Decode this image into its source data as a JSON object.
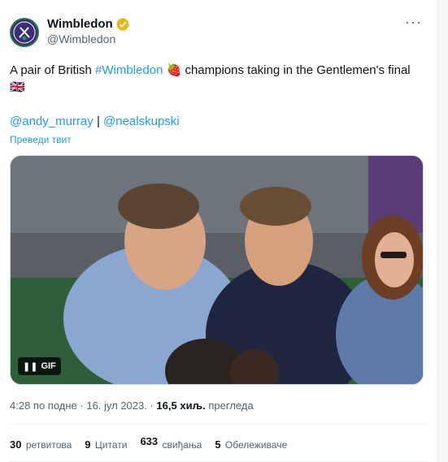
{
  "tweet": {
    "author_name": "Wimbledon",
    "author_handle": "@Wimbledon",
    "text_before_hashtag": "A pair of British ",
    "hashtag": "#Wimbledon",
    "text_after_hashtag": " champions taking in the Gentlemen's final ",
    "strawberry_emoji": "🍓",
    "flag_emoji": "🇬🇧",
    "mention_1": "@andy_murray",
    "mention_separator": " | ",
    "mention_2": "@nealskupski",
    "translate_link": "Преведи твит",
    "media_badge": "GIF",
    "pause_glyph": "❚❚"
  },
  "meta": {
    "time": "4:28 по подне",
    "separator": " · ",
    "date": "16. јул 2023.",
    "views_count": "16,5 хиљ.",
    "views_label": "прегледа"
  },
  "stats": {
    "retweets_count": "30",
    "retweets_label": "ретвитова",
    "quotes_count": "9",
    "quotes_label": "Цитати",
    "likes_count": "633",
    "likes_label": "свиђања",
    "bookmarks_count": "5",
    "bookmarks_label": "Обележиваче"
  },
  "colors": {
    "link": "#1d9bf0",
    "verified": "#e2b719",
    "muted": "#536471"
  },
  "icons": [
    "wimbledon-logo-icon",
    "verified-badge-icon",
    "more-options-icon",
    "pause-icon"
  ]
}
